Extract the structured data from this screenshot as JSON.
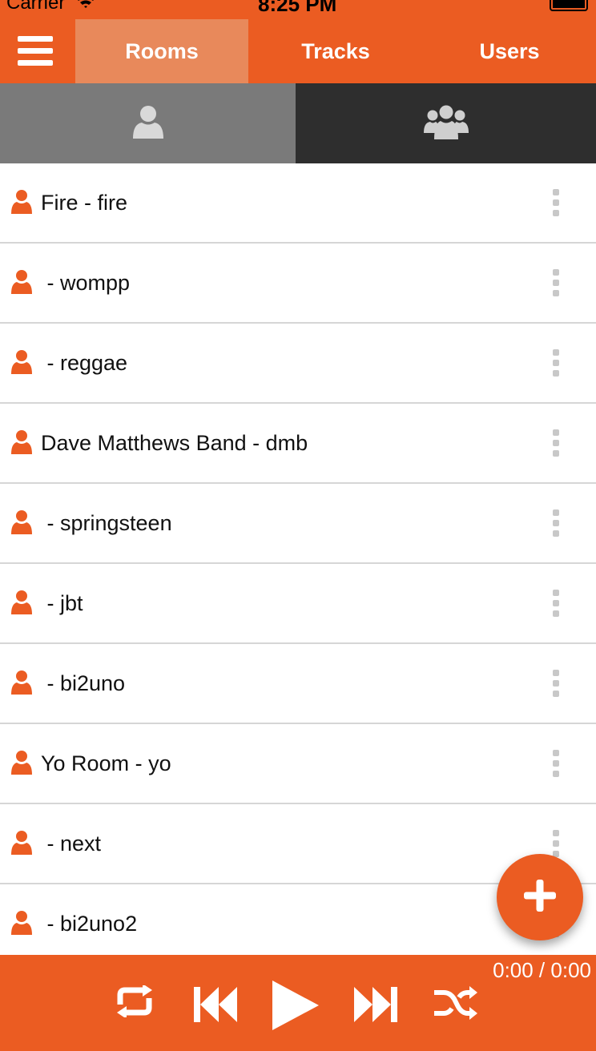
{
  "status_bar": {
    "carrier": "Carrier",
    "time": "8:25 PM"
  },
  "nav": {
    "tabs": [
      {
        "label": "Rooms",
        "active": true
      },
      {
        "label": "Tracks",
        "active": false
      },
      {
        "label": "Users",
        "active": false
      }
    ]
  },
  "segments": {
    "selected": "personal",
    "icons": [
      "user-icon",
      "users-group-icon"
    ]
  },
  "rooms": [
    {
      "label": "Fire - fire"
    },
    {
      "label": " - wompp"
    },
    {
      "label": " - reggae"
    },
    {
      "label": "Dave Matthews Band - dmb"
    },
    {
      "label": " - springsteen"
    },
    {
      "label": " - jbt"
    },
    {
      "label": " - bi2uno"
    },
    {
      "label": "Yo Room - yo"
    },
    {
      "label": " - next"
    },
    {
      "label": " - bi2uno2"
    }
  ],
  "player": {
    "time": "0:00 / 0:00"
  },
  "colors": {
    "accent": "#EB5C22",
    "active_tab": "#E8895B",
    "segment_selected": "#7A7A7A",
    "segment_unselected": "#2E2E2E"
  }
}
